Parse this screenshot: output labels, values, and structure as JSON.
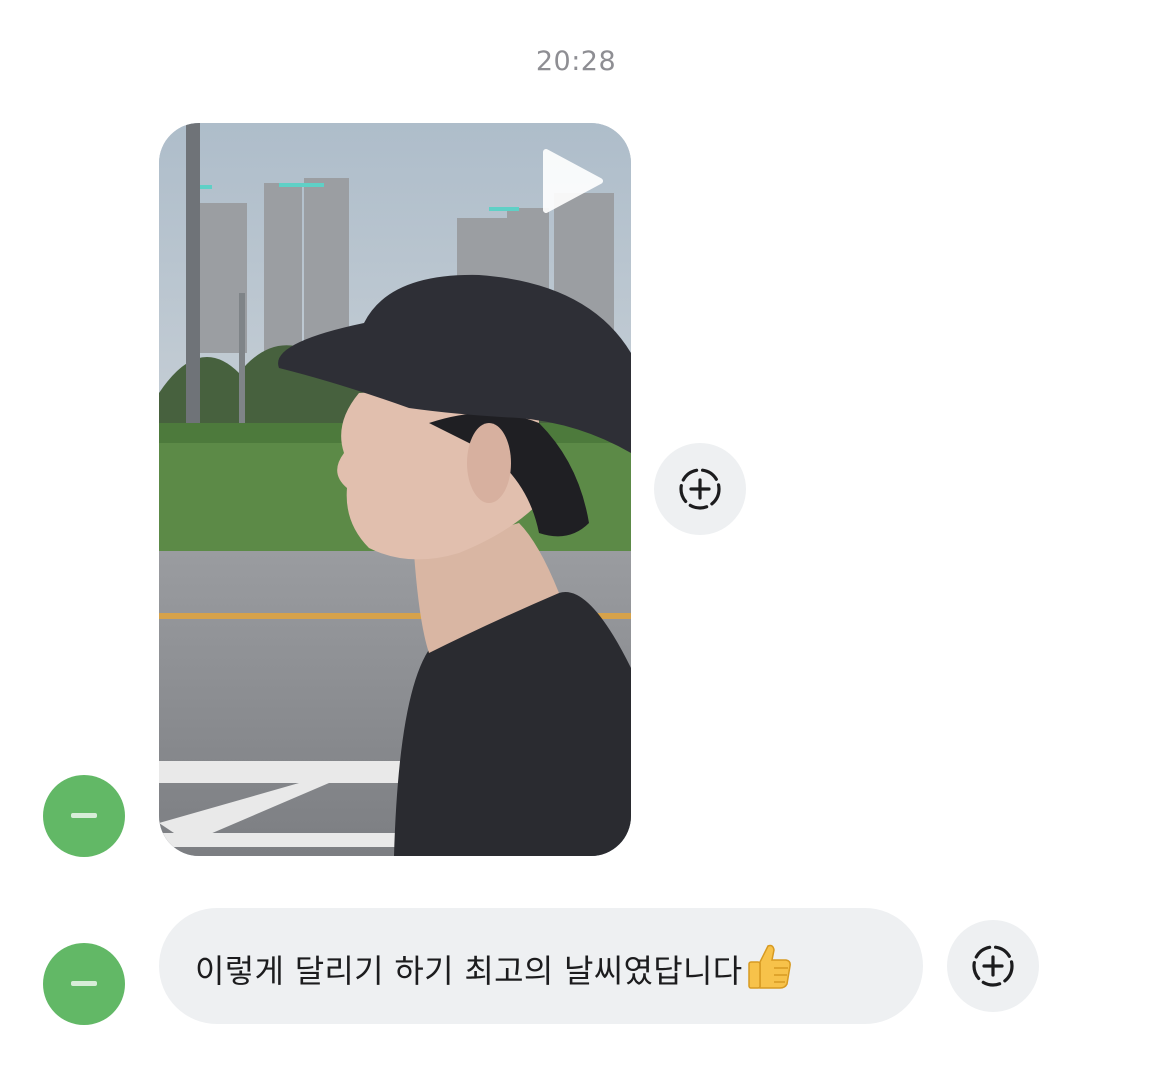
{
  "chat": {
    "timestamp": "20:28",
    "messages": [
      {
        "type": "video",
        "icon": "play-icon"
      },
      {
        "type": "text",
        "text": "이렇게 달리기 하기 최고의 날씨였답니다",
        "emoji": "thumbs-up-icon"
      }
    ],
    "reaction_icon": "dashed-circle-plus-icon"
  },
  "colors": {
    "avatar": "#62b866",
    "bubble": "#eef0f2",
    "timestamp": "#8e8e93",
    "text": "#1c1c1e"
  }
}
